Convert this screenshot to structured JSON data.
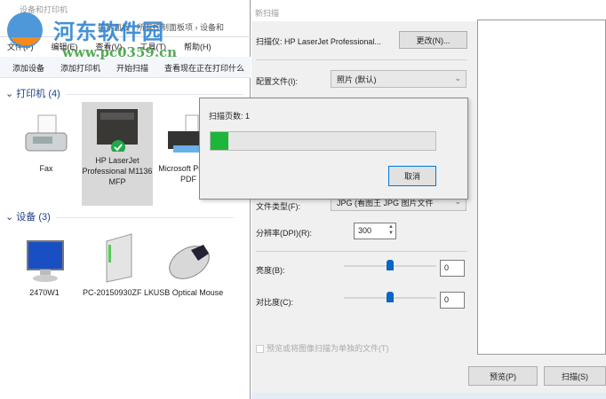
{
  "explorer": {
    "title": "设备和打印机",
    "breadcrumb": [
      "控制面板",
      "所有控制面板项",
      "设备和"
    ],
    "menu": [
      "文件(F)",
      "编辑(E)",
      "查看(V)",
      "工具(T)",
      "帮助(H)"
    ],
    "toolbar": [
      "添加设备",
      "添加打印机",
      "开始扫描",
      "查看现在正在打印什么"
    ],
    "printers_group": "打印机 (4)",
    "printers": [
      "Fax",
      "HP LaserJet Professional M1136 MFP",
      "Microsoft Print to PDF"
    ],
    "devices_group": "设备 (3)",
    "devices": [
      "2470W1",
      "PC-20150930ZF LK",
      "USB Optical Mouse"
    ]
  },
  "watermark": {
    "logo": "河东软件园",
    "url": "www.pc0359.cn"
  },
  "scan_dialog": {
    "title": "新扫描",
    "scanner_label": "扫描仪: HP LaserJet Professional...",
    "change_button": "更改(N)...",
    "profile_label": "配置文件(I):",
    "profile_value": "照片 (默认)",
    "filetype_label": "文件类型(F):",
    "filetype_value": "JPG (看图王 JPG 图片文件",
    "dpi_label": "分辨率(DPI)(R):",
    "dpi_value": "300",
    "brightness_label": "亮度(B):",
    "brightness_value": "0",
    "contrast_label": "对比度(C):",
    "contrast_value": "0",
    "separate_files_checkbox": "预览或将图像扫描为单独的文件(T)",
    "preview_button": "预览(P)",
    "scan_button": "扫描(S)"
  },
  "progress_dialog": {
    "pages_label": "扫描页数: 1",
    "progress_fraction": 0.08,
    "cancel_button": "取消",
    "fill_color": "#1db53a"
  }
}
